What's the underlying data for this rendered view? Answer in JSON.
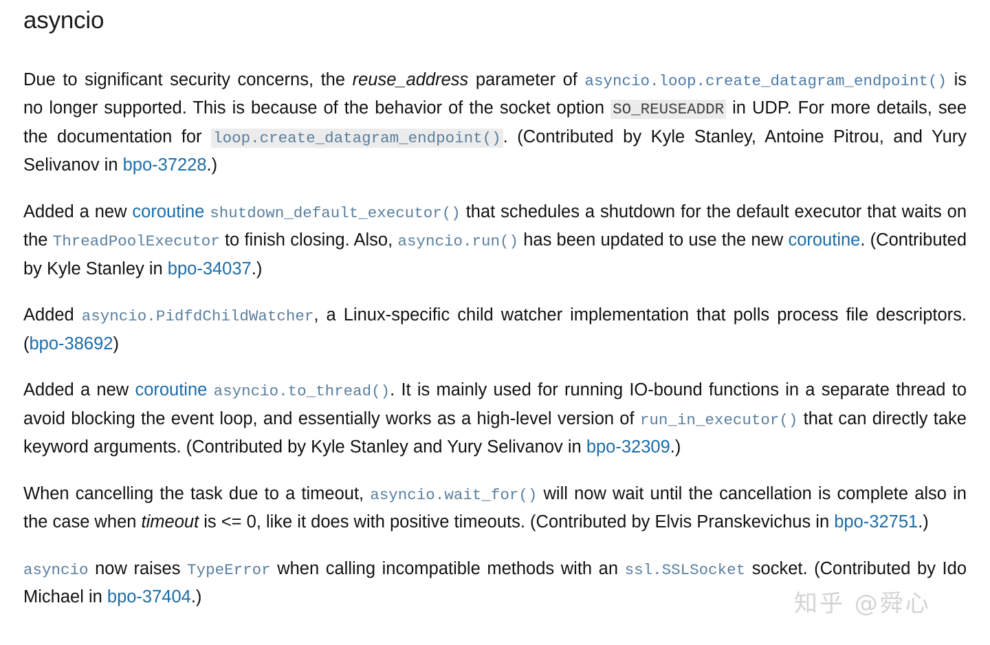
{
  "document": {
    "heading": "asyncio",
    "watermark": "知乎 @舜心",
    "accent_link_color": "#1b6ca8",
    "code_color": "#5a7f9e",
    "code_bg_color": "#ececec",
    "text_color": "#111111"
  },
  "paragraphs": [
    {
      "id": "p1",
      "parts": [
        {
          "type": "text",
          "value": "Due to significant security concerns, the "
        },
        {
          "type": "em",
          "value": "reuse_address"
        },
        {
          "type": "text",
          "value": " parameter of "
        },
        {
          "type": "codelink",
          "value": "asyncio.loop.create_datagram_endpoint()"
        },
        {
          "type": "text",
          "value": " is no longer supported. This is because of the behavior of the socket option "
        },
        {
          "type": "code_boxed",
          "value": "SO_REUSEADDR"
        },
        {
          "type": "text",
          "value": " in UDP. For more details, see the documentation for "
        },
        {
          "type": "code_boxed_link",
          "value": "loop.create_datagram_endpoint()"
        },
        {
          "type": "text",
          "value": ". (Contributed by Kyle Stanley, Antoine Pitrou, and Yury Selivanov in "
        },
        {
          "type": "link",
          "value": "bpo-37228"
        },
        {
          "type": "text",
          "value": ".)"
        }
      ]
    },
    {
      "id": "p2",
      "parts": [
        {
          "type": "text",
          "value": "Added a new "
        },
        {
          "type": "link",
          "value": "coroutine"
        },
        {
          "type": "text",
          "value": " "
        },
        {
          "type": "code",
          "value": "shutdown_default_executor()"
        },
        {
          "type": "text",
          "value": " that schedules a shutdown for the default executor that waits on the "
        },
        {
          "type": "code",
          "value": "ThreadPoolExecutor"
        },
        {
          "type": "text",
          "value": " to finish closing. Also, "
        },
        {
          "type": "code",
          "value": "asyncio.run()"
        },
        {
          "type": "text",
          "value": " has been updated to use the new "
        },
        {
          "type": "link",
          "value": "coroutine"
        },
        {
          "type": "text",
          "value": ". (Contributed by Kyle Stanley in "
        },
        {
          "type": "link",
          "value": "bpo-34037"
        },
        {
          "type": "text",
          "value": ".)"
        }
      ]
    },
    {
      "id": "p3",
      "parts": [
        {
          "type": "text",
          "value": "Added "
        },
        {
          "type": "code",
          "value": "asyncio.PidfdChildWatcher"
        },
        {
          "type": "text",
          "value": ", a Linux-specific child watcher implementation that polls process file descriptors. ("
        },
        {
          "type": "link",
          "value": "bpo-38692"
        },
        {
          "type": "text",
          "value": ")"
        }
      ]
    },
    {
      "id": "p4",
      "parts": [
        {
          "type": "text",
          "value": "Added a new "
        },
        {
          "type": "link",
          "value": "coroutine"
        },
        {
          "type": "text",
          "value": " "
        },
        {
          "type": "code",
          "value": "asyncio.to_thread()"
        },
        {
          "type": "text",
          "value": ". It is mainly used for running IO-bound functions in a separate thread to avoid blocking the event loop, and essentially works as a high-level version of "
        },
        {
          "type": "code",
          "value": "run_in_executor()"
        },
        {
          "type": "text",
          "value": " that can directly take keyword arguments. (Contributed by Kyle Stanley and Yury Selivanov in "
        },
        {
          "type": "link",
          "value": "bpo-32309"
        },
        {
          "type": "text",
          "value": ".)"
        }
      ]
    },
    {
      "id": "p5",
      "parts": [
        {
          "type": "text",
          "value": "When cancelling the task due to a timeout, "
        },
        {
          "type": "code",
          "value": "asyncio.wait_for()"
        },
        {
          "type": "text",
          "value": " will now wait until the cancellation is complete also in the case when "
        },
        {
          "type": "em",
          "value": "timeout"
        },
        {
          "type": "text",
          "value": " is <= 0, like it does with positive timeouts. (Contributed by Elvis Pranskevichus in "
        },
        {
          "type": "link",
          "value": "bpo-32751"
        },
        {
          "type": "text",
          "value": ".)"
        }
      ]
    },
    {
      "id": "p6",
      "parts": [
        {
          "type": "code",
          "value": "asyncio"
        },
        {
          "type": "text",
          "value": " now raises "
        },
        {
          "type": "code",
          "value": "TypeError"
        },
        {
          "type": "text",
          "value": " when calling incompatible methods with an "
        },
        {
          "type": "code",
          "value": "ssl.SSLSocket"
        },
        {
          "type": "text",
          "value": " socket. (Contributed by Ido Michael in "
        },
        {
          "type": "link",
          "value": "bpo-37404"
        },
        {
          "type": "text",
          "value": ".)"
        }
      ]
    }
  ]
}
